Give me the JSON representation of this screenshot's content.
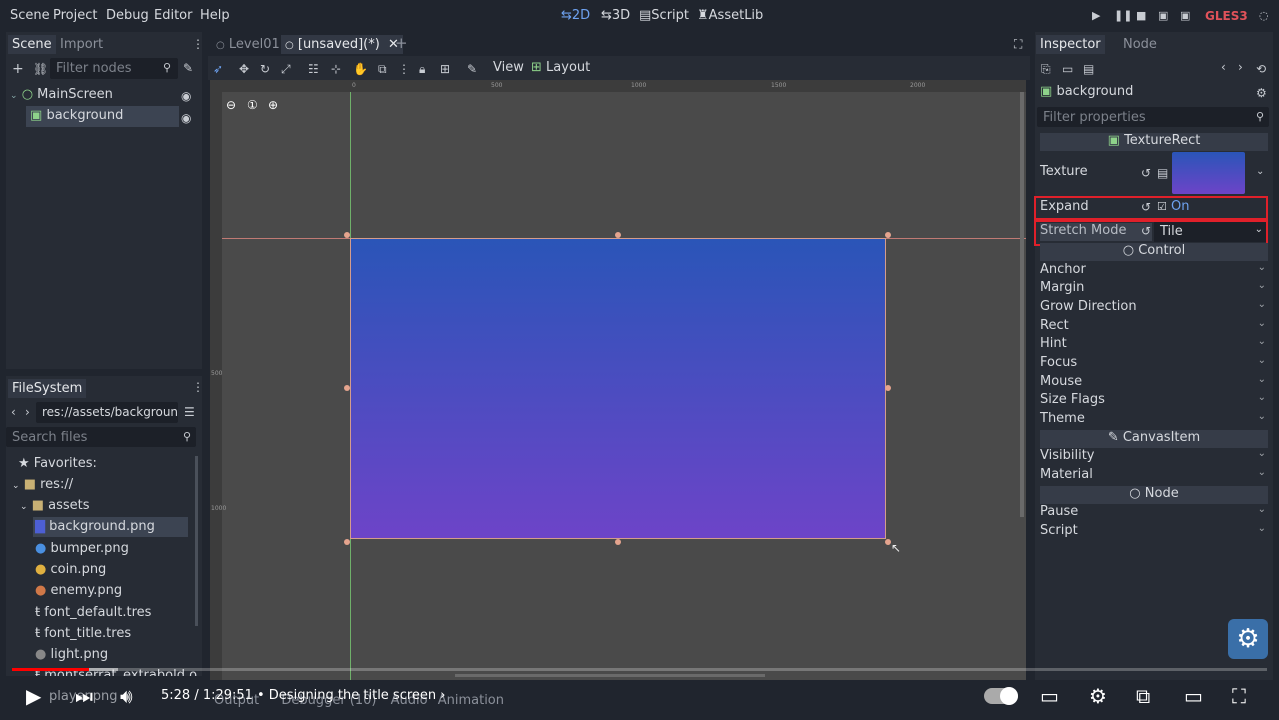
{
  "menu": {
    "items": [
      "Scene",
      "Project",
      "Debug",
      "Editor",
      "Help"
    ]
  },
  "workspaces": {
    "2d": "2D",
    "3d": "3D",
    "script": "Script",
    "assetlib": "AssetLib"
  },
  "renderer": "GLES3",
  "scene_panel": {
    "tabs": [
      "Scene",
      "Import"
    ],
    "filter_placeholder": "Filter nodes",
    "nodes": [
      {
        "label": "MainScreen",
        "selected": false
      },
      {
        "label": "background",
        "selected": true
      }
    ]
  },
  "filesystem": {
    "tab": "FileSystem",
    "path": "res://assets/backgroun",
    "search_placeholder": "Search files",
    "favorites": "Favorites:",
    "root": "res://",
    "folder": "assets",
    "files": [
      "background.png",
      "bumper.png",
      "coin.png",
      "enemy.png",
      "font_default.tres",
      "font_title.tres",
      "light.png",
      "montserrat_extrabold.o"
    ],
    "partial_file": "player.png"
  },
  "editor_tabs": [
    {
      "label": "Level01",
      "active": false
    },
    {
      "label": "[unsaved](*)",
      "active": true
    }
  ],
  "toolbar": {
    "view": "View",
    "layout": "Layout"
  },
  "rulers": {
    "h": [
      "0",
      "500",
      "1000",
      "1500",
      "2000"
    ],
    "v": [
      "500",
      "1000"
    ]
  },
  "bottom_tabs": [
    "Output",
    "Debugger (10)",
    "Audio",
    "Animation"
  ],
  "inspector": {
    "tabs": [
      "Inspector",
      "Node"
    ],
    "object": "background",
    "filter_placeholder": "Filter properties",
    "class": "TextureRect",
    "texture_label": "Texture",
    "expand_label": "Expand",
    "expand_value": "On",
    "stretch_label": "Stretch Mode",
    "stretch_value": "Tile",
    "control_section": "Control",
    "control_props": [
      "Anchor",
      "Margin",
      "Grow Direction",
      "Rect",
      "Hint",
      "Focus",
      "Mouse",
      "Size Flags",
      "Theme"
    ],
    "canvas_section": "CanvasItem",
    "canvas_props": [
      "Visibility",
      "Material"
    ],
    "node_section": "Node",
    "node_props": [
      "Pause",
      "Script"
    ]
  },
  "video": {
    "time": "5:28 / 1:29:51",
    "chapter": "• Designing the title screen",
    "progress": 0.061
  },
  "colors": {
    "accent": "#6ea2f0",
    "highlight_box": "#e0202a",
    "progress": "#ff0000"
  }
}
